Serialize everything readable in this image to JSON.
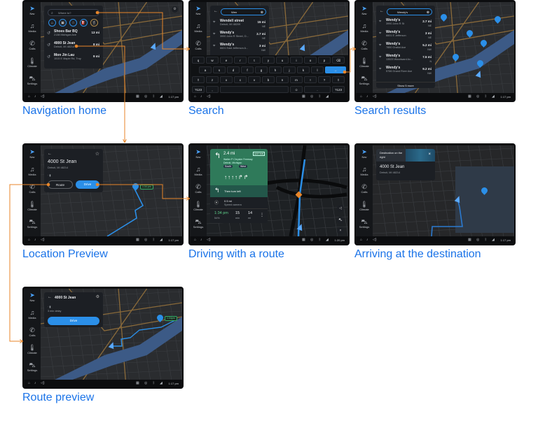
{
  "sidebar": {
    "items": [
      {
        "label": "Nav",
        "icon": "navigation-arrow-icon"
      },
      {
        "label": "Media",
        "icon": "music-note-icon"
      },
      {
        "label": "Calls",
        "icon": "phone-icon"
      },
      {
        "label": "Climate",
        "icon": "thermometer-icon"
      },
      {
        "label": "Settings",
        "icon": "car-icon"
      }
    ]
  },
  "colors": {
    "accent": "#2b8fe8",
    "connector": "#e8862a",
    "label": "#1a73e8",
    "map_bg": "#2a2c2f",
    "panel": "#1c1f24",
    "guidance": "#2f7a5a"
  },
  "screens": {
    "nav_home": {
      "caption": "Navigation home",
      "time": "1:17 pm",
      "search_placeholder": "Where to?",
      "categories": [
        "home-icon",
        "work-icon",
        "star-icon",
        "gas-station-icon",
        "restaurant-icon"
      ],
      "recents": [
        {
          "name": "Shoes Bar BQ",
          "address": "2138 Michigan Ave",
          "distance": "13 mi"
        },
        {
          "name": "4000 St Jean",
          "address": "Detroit, MI 48214",
          "distance": "8 mi"
        },
        {
          "name": "Mon Jin Lau",
          "address": "1515 E Maple Rd, Troy",
          "distance": "9 mi"
        }
      ]
    },
    "search": {
      "caption": "Search",
      "query": "Wen",
      "results": [
        {
          "name": "Wendell street",
          "address": "Detroit, MI 48209",
          "distance": "15 mi",
          "direction": "NE"
        },
        {
          "name": "Wendy's",
          "address": "3990 John R Street, D...",
          "distance": "2.7 mi",
          "direction": "NE"
        },
        {
          "name": "Wendy's",
          "address": "6601 East Jefferson A...",
          "distance": "3 mi",
          "direction": "NW"
        }
      ],
      "keyboard": {
        "row1": [
          "q",
          "w",
          "e",
          "r",
          "t",
          "y",
          "u",
          "i",
          "o",
          "p",
          "⌫"
        ],
        "row2": [
          "a",
          "s",
          "d",
          "f",
          "g",
          "h",
          "j",
          "k",
          "l",
          "→"
        ],
        "row3": [
          "⇧",
          "z",
          "x",
          "c",
          "v",
          "b",
          "n",
          "m",
          "!",
          "?",
          "⇧"
        ],
        "row4": [
          "?123",
          ",",
          " ",
          "☺",
          ".",
          "?123"
        ]
      }
    },
    "results": {
      "caption": "Search results",
      "time": "1:17 pm",
      "query": "Wendy's",
      "show_more": "Show 5 more",
      "results": [
        {
          "name": "Wendy's",
          "address": "3990 John R St",
          "distance": "2.7 mi",
          "direction": "NE"
        },
        {
          "name": "Wendy's",
          "address": "6601 E Jefferson",
          "distance": "3 mi",
          "direction": "NE"
        },
        {
          "name": "Wendy's",
          "address": "7850 Gratiot Ave",
          "distance": "5.2 mi",
          "direction": "NW"
        },
        {
          "name": "Wendy's",
          "address": "13525 Woodward Av...",
          "distance": "7.5 mi",
          "direction": "N"
        },
        {
          "name": "Wendy's",
          "address": "5766 Grand River Ave",
          "distance": "9.2 mi",
          "direction": "NW"
        }
      ]
    },
    "location_preview": {
      "caption": "Location Preview",
      "time": "1:17 pm",
      "name": "4000 St Jean",
      "address": "Detroit, MI 48214",
      "duration": "17 min",
      "distance": "15 mi",
      "battery": "54%",
      "route_label": "Route",
      "drive_label": "Drive",
      "eta": "1:34 pm"
    },
    "driving": {
      "caption": "Driving with a route",
      "time": "1:20 pm",
      "maneuver_distance": "2.4 mi",
      "exit_badge": "EXIT 50B",
      "road": "Walter P Chrysler Freeway",
      "city": "Detroit, Michigan",
      "shields": [
        "South",
        "West"
      ],
      "then": "Then turn left",
      "alert_distance": "0.5 mi",
      "alert": "Speed camera",
      "arrival": "1:34 pm",
      "battery": "54%",
      "remaining_time": "15",
      "remaining_time_unit": "min",
      "remaining_distance": "14",
      "remaining_distance_unit": "mi"
    },
    "arriving": {
      "caption": "Arriving at the destination",
      "time": "1:17 pm",
      "banner": "Destination on the right",
      "name": "4000 St Jean",
      "address": "Detroit, MI 48214"
    },
    "route_preview": {
      "caption": "Route preview",
      "time": "1:17 pm",
      "name": "4000 St Jean",
      "duration": "17 min",
      "distance": "15 mi",
      "battery": "54%",
      "delay": "3 min delay",
      "drive_label": "Drive",
      "eta": "1:34pm"
    }
  }
}
